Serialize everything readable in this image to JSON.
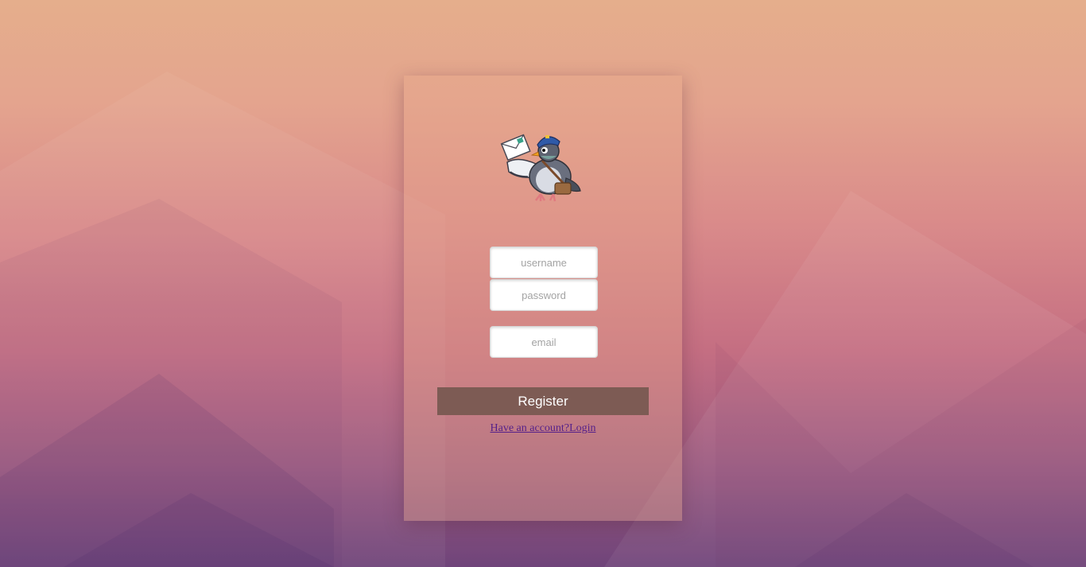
{
  "background": {
    "top_color": "#e5ae8c",
    "bottom_color": "#6f447a"
  },
  "logo": {
    "icon": "pigeon-mail-carrier-icon"
  },
  "form": {
    "username_placeholder": "username",
    "password_placeholder": "password",
    "email_placeholder": "email",
    "register_label": "Register",
    "register_color": "#7d5b54",
    "login_link": "Have an account?Login"
  }
}
